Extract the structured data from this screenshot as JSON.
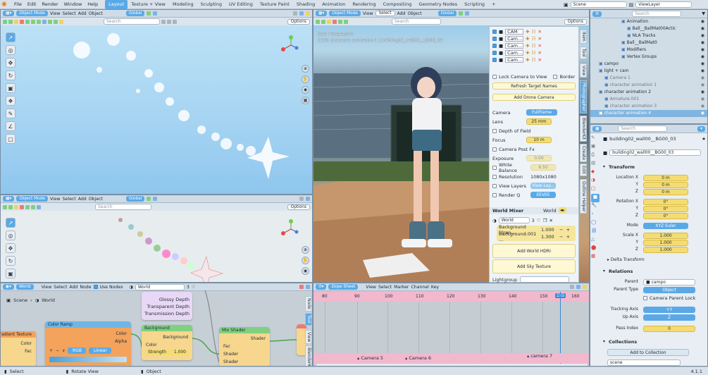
{
  "menubar": {
    "items": [
      "File",
      "Edit",
      "Render",
      "Window",
      "Help"
    ],
    "workspaces": [
      "Layout",
      "Texture + View",
      "Modeling",
      "Sculpting",
      "UV Editing",
      "Texture Paint",
      "Shading",
      "Animation",
      "Rendering",
      "Compositing",
      "Geometry Nodes",
      "Scripting"
    ],
    "active_workspace": "Layout",
    "add_tab": "+",
    "scene": "Scene",
    "view_layer": "ViewLayer"
  },
  "viewport_header": {
    "mode": "Object Mode",
    "menus": [
      "View",
      "Select",
      "Add",
      "Object"
    ],
    "transform": "Global",
    "search_placeholder": "Search",
    "options": "Options"
  },
  "stadium_viewport": {
    "overlay_line1": "User Perspective",
    "overlay_line2": "(155) character animation 4 | building02_wall00__BG00_03"
  },
  "camera_panel": {
    "cameras": [
      "CAM ...",
      "Cam...",
      "Cam...",
      "Cam...",
      "Cam..."
    ],
    "lock_camera": "Lock Camera to View",
    "border": "Border",
    "refresh": "Refresh Target Names",
    "add_drone": "Add Drone Camera",
    "camera_label": "Camera",
    "camera_value": "Fullframe",
    "lens_label": "Lens",
    "lens_value": "25 mm",
    "dof": "Depth of Field",
    "focus_label": "Focus",
    "focus_value": "10 m",
    "camera_post": "Camera Post Fx",
    "exposure_label": "Exposure",
    "exposure_value": "0.00",
    "white_balance_label": "White Balance",
    "white_balance_value": "6.50",
    "resolution_label": "Resolution",
    "resolution_value": "1080x1080",
    "view_layers_label": "View Layers",
    "view_layers_value": "View Lay...",
    "render_q_label": "Render Q",
    "render_q_value": "EEVEE",
    "world_mixer": "World Mixer",
    "world_mixer_value": "World",
    "world_name": "World",
    "world_users": "3",
    "bg_strength_label": "Background Stren...",
    "bg_strength_value": "1.000",
    "bg001_label": "Background.001 ...",
    "bg001_value": "1.300",
    "add_hdri": "Add World HDRI",
    "add_sky": "Add Sky Texture",
    "lightgroup": "Lightgroup"
  },
  "side_tabs": [
    "Item",
    "Tool",
    "View",
    "Photographer",
    "BlenderKit",
    "Create",
    "Edit",
    "Outline Helper"
  ],
  "outliner": {
    "rows": [
      {
        "label": "Animation",
        "indent": 5,
        "icon": "anim-icon"
      },
      {
        "label": "Ball__BallMat00Actic",
        "indent": 6,
        "icon": "action-icon"
      },
      {
        "label": "NLA Tracks",
        "indent": 6,
        "icon": "nla-icon"
      },
      {
        "label": "Ball__BallMat0",
        "indent": 5,
        "icon": "mesh-icon"
      },
      {
        "label": "Modifiers",
        "indent": 5,
        "icon": "wrench-icon"
      },
      {
        "label": "Vertex Groups",
        "indent": 5,
        "icon": "vgroup-icon"
      },
      {
        "label": "campo",
        "indent": 1,
        "icon": "collection-icon"
      },
      {
        "label": "light + cam",
        "indent": 1,
        "icon": "collection-icon"
      },
      {
        "label": "Camera 1",
        "indent": 2,
        "icon": "camera-icon",
        "dim": true
      },
      {
        "label": "character animation 1",
        "indent": 2,
        "icon": "armature-icon",
        "dim": true
      },
      {
        "label": "character animation 2",
        "indent": 1,
        "icon": "collection-icon"
      },
      {
        "label": "Armature.001",
        "indent": 2,
        "icon": "armature-icon",
        "dim": true
      },
      {
        "label": "character animation 3",
        "indent": 2,
        "icon": "armature-icon",
        "dim": true
      },
      {
        "label": "character animation 4",
        "indent": 1,
        "icon": "collection-icon",
        "sel": true
      }
    ]
  },
  "properties": {
    "search_placeholder": "Search",
    "object_path": "building02_wall00__BG00_03",
    "object_name": "building02_wall00__BG00_03",
    "transform": "Transform",
    "location": {
      "label": "Location X",
      "y": "Y",
      "z": "Z",
      "values": [
        "0 m",
        "0 m",
        "0 m"
      ]
    },
    "rotation": {
      "label": "Rotation X",
      "y": "Y",
      "z": "Z",
      "values": [
        "0°",
        "0°",
        "0°"
      ]
    },
    "mode_label": "Mode",
    "mode_value": "XYZ Euler",
    "scale": {
      "label": "Scale X",
      "y": "Y",
      "z": "Z",
      "values": [
        "1.000",
        "1.000",
        "1.000"
      ]
    },
    "delta": "Delta Transform",
    "relations": "Relations",
    "parent_label": "Parent",
    "parent_value": "campo",
    "parent_type_label": "Parent Type",
    "parent_type_value": "Object",
    "camera_parent_lock": "Camera Parent Lock",
    "tracking_label": "Tracking Axis",
    "tracking_value": "+Y",
    "up_label": "Up Axis",
    "up_value": "Z",
    "pass_label": "Pass Index",
    "pass_value": "0",
    "collections": "Collections",
    "add_to_collection": "Add to Collection",
    "collection_name": "scene",
    "version": "4.1.1"
  },
  "node_editor": {
    "type": "World",
    "menus": [
      "View",
      "Select",
      "Add",
      "Node"
    ],
    "use_nodes": "Use Nodes",
    "world_name": "World",
    "world_users": "3",
    "breadcrumb": [
      "Scene",
      "World"
    ],
    "nodes": {
      "light_path_outputs": [
        "Glossy Depth",
        "Transparent Depth",
        "Transmission Depth"
      ],
      "gradient": "Gradient Texture",
      "gradient_outputs": [
        "Color",
        "Fac"
      ],
      "color_ramp": "Color Ramp",
      "color_ramp_outputs": [
        "Color",
        "Alpha"
      ],
      "color_ramp_mode": "RGB",
      "color_ramp_interp": "Linear",
      "background": "Background",
      "background_output": "Background",
      "background_color": "Color",
      "background_strength_label": "Strength",
      "background_strength": "1.000",
      "mix": "Mix Shader",
      "mix_output": "Shader",
      "mix_inputs": [
        "Fac",
        "Shader",
        "Shader"
      ]
    },
    "side_tabs": [
      "Node",
      "Tool",
      "View",
      "BlenderKit"
    ]
  },
  "dopesheet": {
    "mode": "Dope Sheet",
    "menus": [
      "View",
      "Select",
      "Marker",
      "Channel",
      "Key"
    ],
    "frames": [
      "80",
      "90",
      "100",
      "110",
      "120",
      "130",
      "140",
      "150",
      "155",
      "160"
    ],
    "current_frame": "155",
    "markers": [
      "Camera 5",
      "Camera 6",
      "camera 7"
    ]
  },
  "statusbar": {
    "items": [
      "Select",
      "Rotate View",
      "Object"
    ]
  }
}
